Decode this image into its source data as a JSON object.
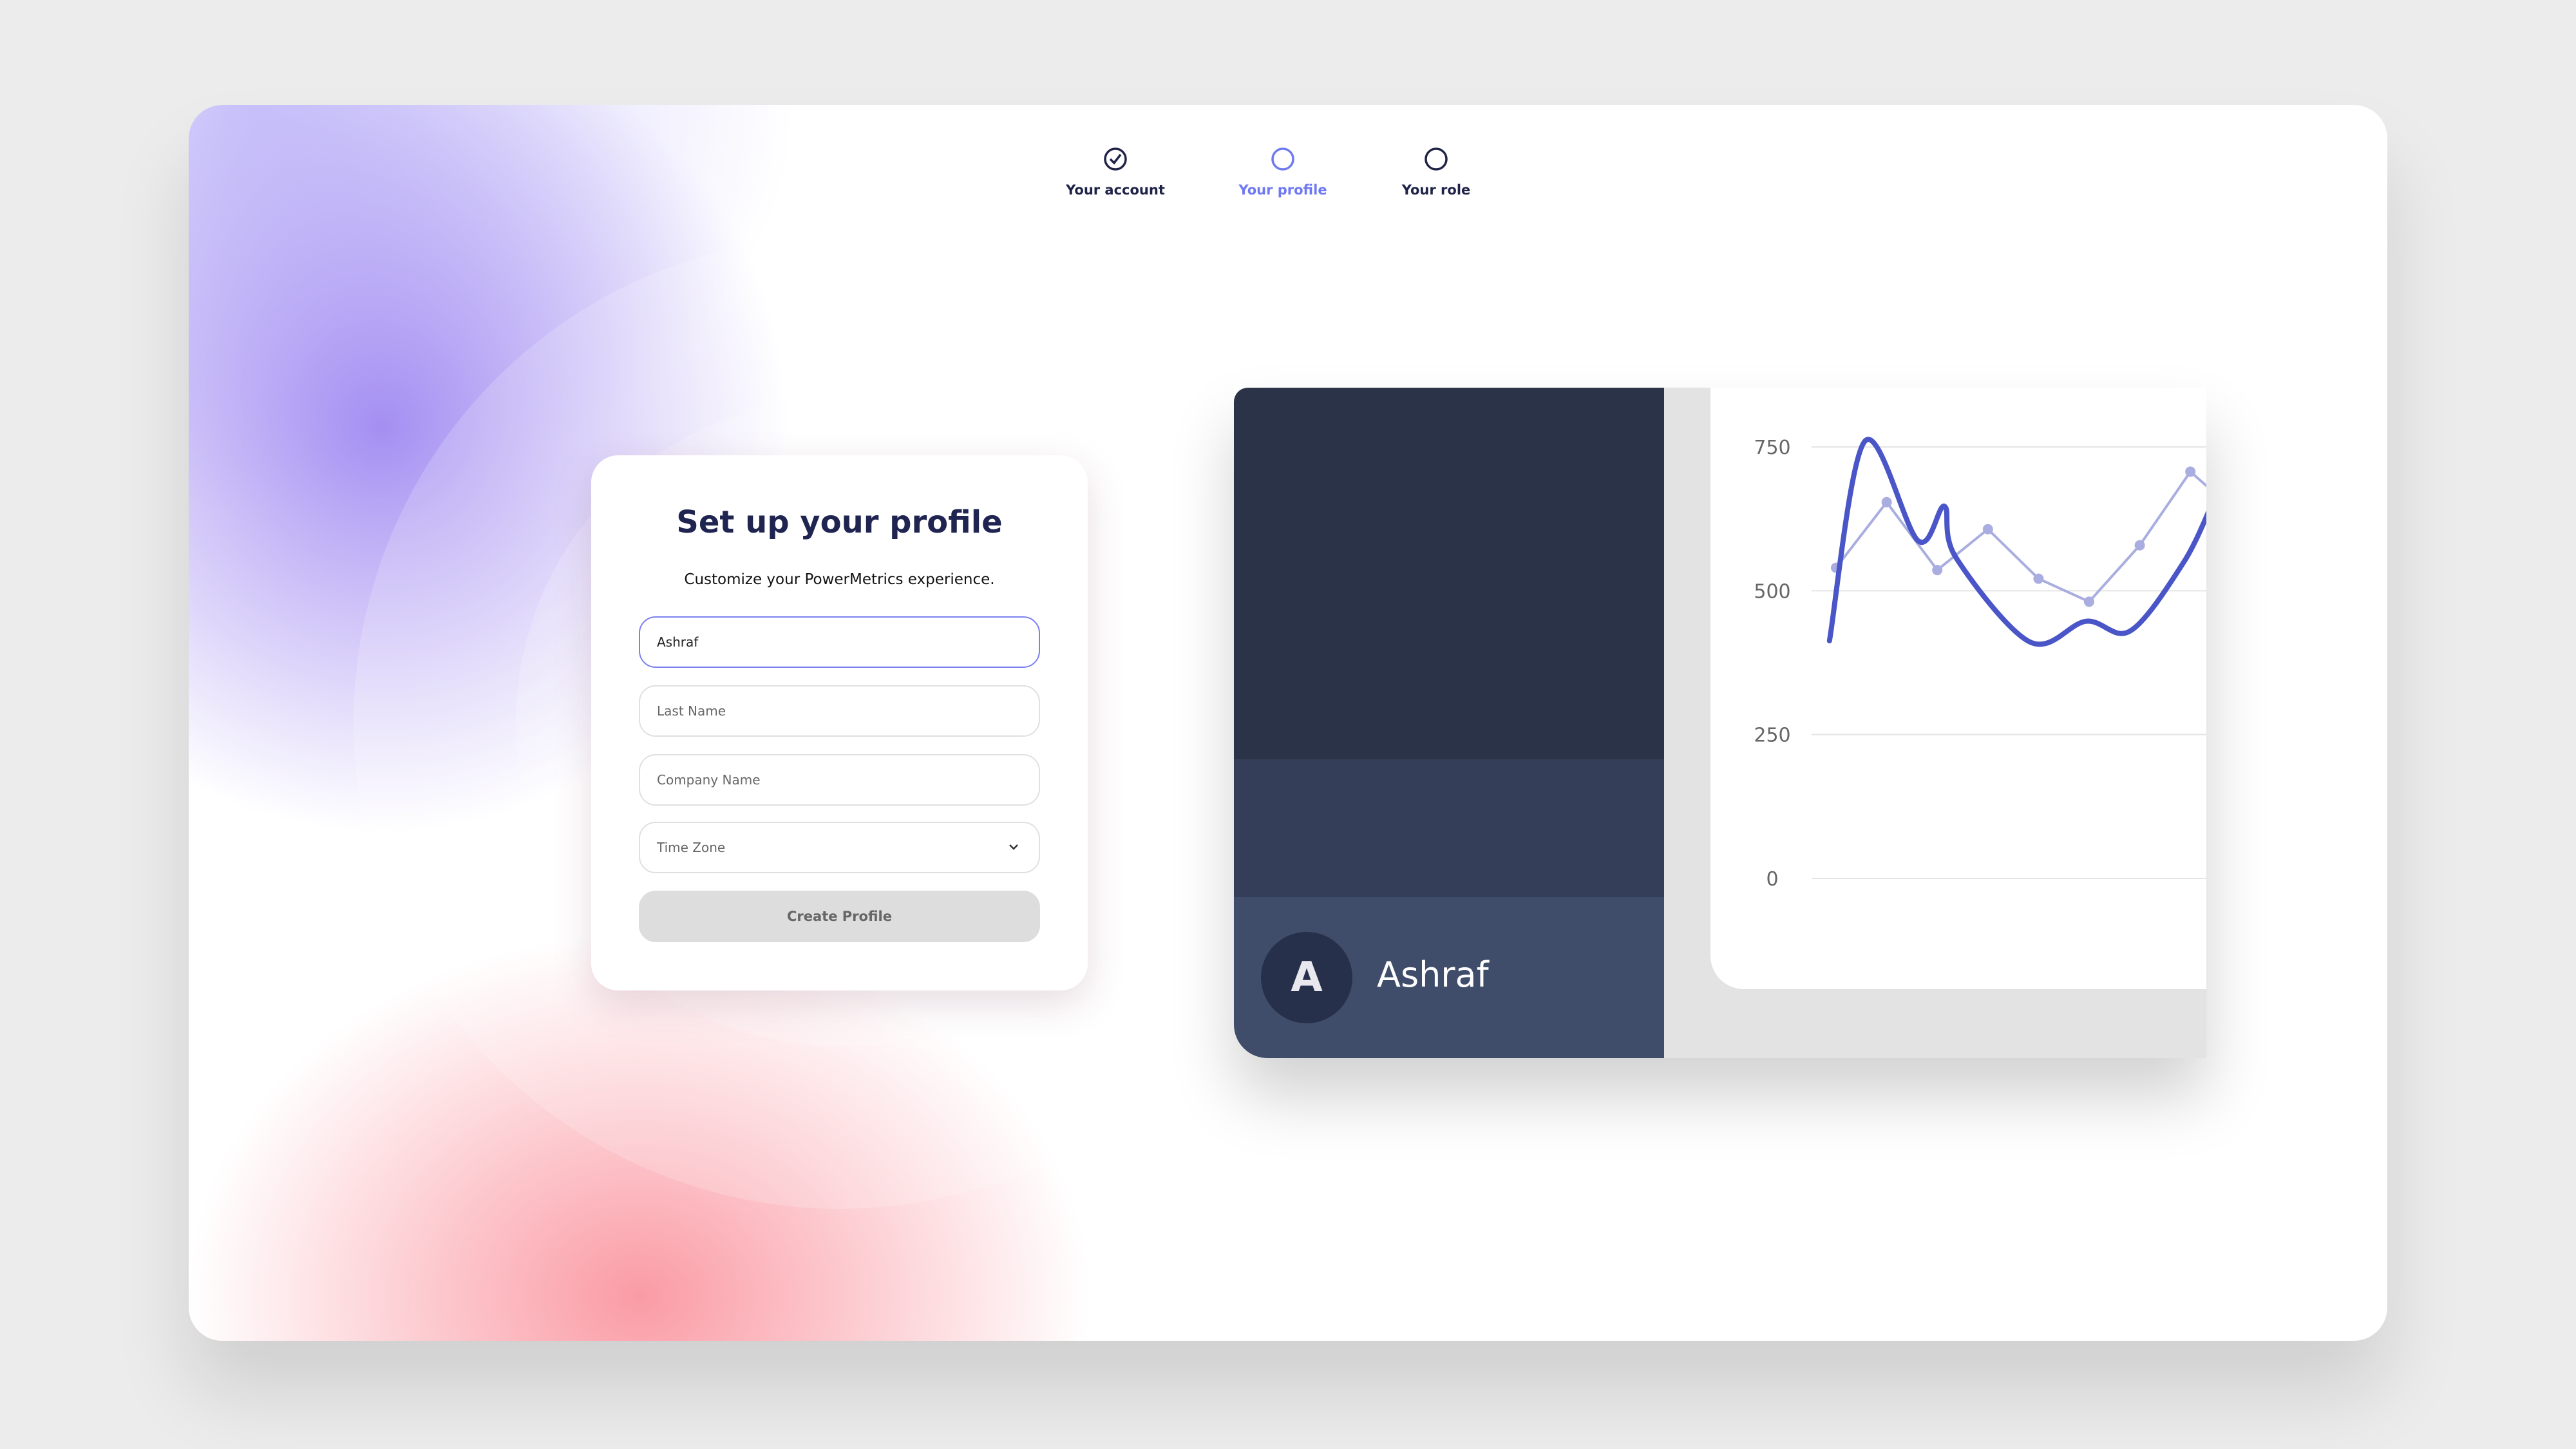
{
  "stepper": {
    "steps": [
      {
        "label": "Your account",
        "state": "completed",
        "icon": "check-circle-icon"
      },
      {
        "label": "Your profile",
        "state": "current",
        "icon": "circle-icon"
      },
      {
        "label": "Your role",
        "state": "pending",
        "icon": "circle-icon"
      }
    ],
    "colors": {
      "completed": "#1f2348",
      "current": "#6f7af0",
      "pending": "#1f2348"
    }
  },
  "form": {
    "title": "Set up your profile",
    "subtitle": "Customize your PowerMetrics experience.",
    "first_name": {
      "value": "Ashraf"
    },
    "last_name": {
      "placeholder": "Last Name"
    },
    "company_name": {
      "placeholder": "Company Name"
    },
    "time_zone": {
      "placeholder": "Time Zone",
      "icon": "chevron-down-icon"
    },
    "submit_label": "Create Profile"
  },
  "preview": {
    "avatar_initial": "A",
    "user_name": "Ashraf"
  },
  "chart_data": {
    "type": "line",
    "ylim": [
      0,
      750
    ],
    "yticks": [
      "750",
      "500",
      "250",
      "0"
    ],
    "grid": true,
    "series": [
      {
        "style": "points",
        "color": "#a9addf",
        "x": [
          0,
          1,
          2,
          3,
          4,
          5,
          6,
          7,
          7.4
        ],
        "values": [
          540,
          654,
          536,
          607,
          521,
          481,
          579,
          707,
          676
        ]
      },
      {
        "style": "smooth",
        "color": "#4a55c8",
        "x": [
          -0.13,
          0.57,
          1.62,
          2.14,
          2.36,
          3.83,
          4.94,
          5.81,
          6.85,
          7.4
        ],
        "values": [
          413,
          760,
          587,
          647,
          559,
          411,
          447,
          430,
          547,
          645
        ]
      }
    ]
  }
}
